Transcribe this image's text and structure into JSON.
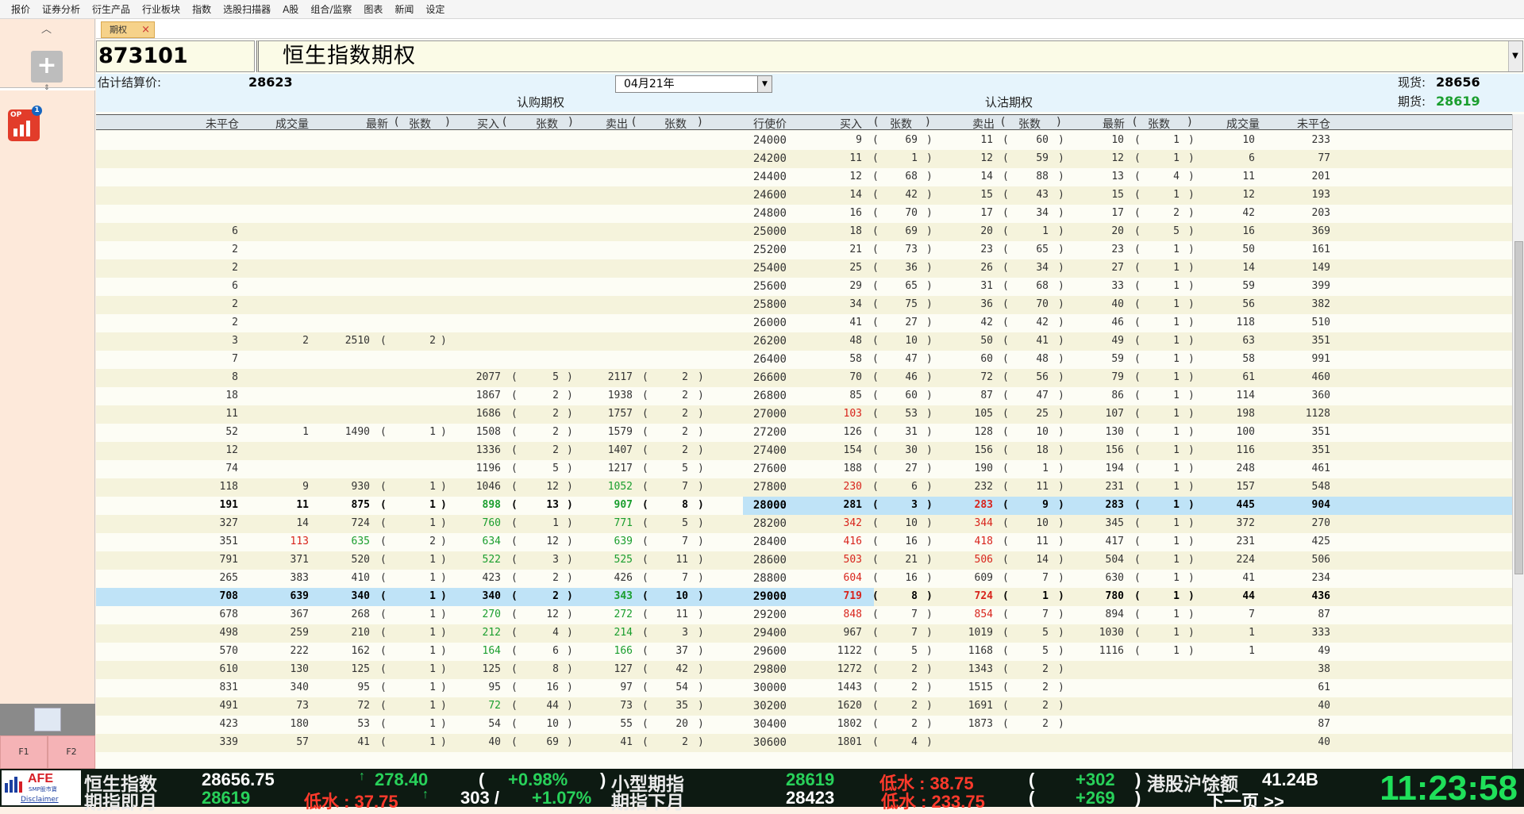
{
  "menu": [
    "报价",
    "证券分析",
    "衍生产品",
    "行业板块",
    "指数",
    "选股扫描器",
    "A股",
    "组合/监察",
    "图表",
    "新闻",
    "设定"
  ],
  "sidebar": {
    "f1": "F1",
    "f2": "F2",
    "op_badge": "1",
    "op_label": "OP"
  },
  "tab": {
    "label": "期权",
    "close": "×"
  },
  "header": {
    "code": "873101",
    "title": "恒生指数期权"
  },
  "info": {
    "est_settle_label": "估计结算价:",
    "est_settle_value": "28623",
    "spot_label": "现货:",
    "spot_value": "28656",
    "futures_label": "期货:",
    "futures_value": "28619",
    "call_label": "认购期权",
    "put_label": "认沽期权",
    "expiry": "04月21年"
  },
  "columns": {
    "oi": "未平仓",
    "vol": "成交量",
    "last": "最新",
    "lots": "张数",
    "bid": "买入",
    "ask": "卖出",
    "strike": "行使价",
    "open_paren": "(",
    "close_paren": ")"
  },
  "rows": [
    {
      "strike": "24000",
      "c": [
        "",
        "",
        "",
        "",
        "",
        "",
        "",
        "",
        ""
      ],
      "p": [
        "9",
        "69",
        "11",
        "60",
        "10",
        "1",
        "10",
        "233"
      ],
      "pc": [
        "",
        "",
        "",
        "",
        "",
        "",
        "",
        ""
      ]
    },
    {
      "strike": "24200",
      "c": [
        "",
        "",
        "",
        "",
        "",
        "",
        "",
        "",
        ""
      ],
      "p": [
        "11",
        "1",
        "12",
        "59",
        "12",
        "1",
        "6",
        "77"
      ],
      "pc": [
        "",
        "",
        "",
        "",
        "",
        "",
        "",
        ""
      ]
    },
    {
      "strike": "24400",
      "c": [
        "",
        "",
        "",
        "",
        "",
        "",
        "",
        "",
        ""
      ],
      "p": [
        "12",
        "68",
        "14",
        "88",
        "13",
        "4",
        "11",
        "201"
      ],
      "pc": [
        "",
        "",
        "",
        "",
        "",
        "",
        "",
        ""
      ]
    },
    {
      "strike": "24600",
      "c": [
        "",
        "",
        "",
        "",
        "",
        "",
        "",
        "",
        ""
      ],
      "p": [
        "14",
        "42",
        "15",
        "43",
        "15",
        "1",
        "12",
        "193"
      ],
      "pc": [
        "",
        "",
        "",
        "",
        "",
        "",
        "",
        ""
      ]
    },
    {
      "strike": "24800",
      "c": [
        "",
        "",
        "",
        "",
        "",
        "",
        "",
        "",
        ""
      ],
      "p": [
        "16",
        "70",
        "17",
        "34",
        "17",
        "2",
        "42",
        "203"
      ],
      "pc": [
        "",
        "",
        "",
        "",
        "",
        "",
        "",
        ""
      ]
    },
    {
      "strike": "25000",
      "c": [
        "6",
        "",
        "",
        "",
        "",
        "",
        "",
        "",
        ""
      ],
      "p": [
        "18",
        "69",
        "20",
        "1",
        "20",
        "5",
        "16",
        "369"
      ],
      "pc": [
        "",
        "",
        "",
        "",
        "",
        "",
        "",
        ""
      ]
    },
    {
      "strike": "25200",
      "c": [
        "2",
        "",
        "",
        "",
        "",
        "",
        "",
        "",
        ""
      ],
      "p": [
        "21",
        "73",
        "23",
        "65",
        "23",
        "1",
        "50",
        "161"
      ],
      "pc": [
        "",
        "",
        "",
        "",
        "",
        "",
        "",
        ""
      ]
    },
    {
      "strike": "25400",
      "c": [
        "2",
        "",
        "",
        "",
        "",
        "",
        "",
        "",
        ""
      ],
      "p": [
        "25",
        "36",
        "26",
        "34",
        "27",
        "1",
        "14",
        "149"
      ],
      "pc": [
        "",
        "",
        "",
        "",
        "",
        "",
        "",
        ""
      ]
    },
    {
      "strike": "25600",
      "c": [
        "6",
        "",
        "",
        "",
        "",
        "",
        "",
        "",
        ""
      ],
      "p": [
        "29",
        "65",
        "31",
        "68",
        "33",
        "1",
        "59",
        "399"
      ],
      "pc": [
        "",
        "",
        "",
        "",
        "",
        "",
        "",
        ""
      ]
    },
    {
      "strike": "25800",
      "c": [
        "2",
        "",
        "",
        "",
        "",
        "",
        "",
        "",
        ""
      ],
      "p": [
        "34",
        "75",
        "36",
        "70",
        "40",
        "1",
        "56",
        "382"
      ],
      "pc": [
        "",
        "",
        "",
        "",
        "",
        "",
        "",
        ""
      ]
    },
    {
      "strike": "26000",
      "c": [
        "2",
        "",
        "",
        "",
        "",
        "",
        "",
        "",
        ""
      ],
      "p": [
        "41",
        "27",
        "42",
        "42",
        "46",
        "1",
        "118",
        "510"
      ],
      "pc": [
        "",
        "",
        "",
        "",
        "",
        "",
        "",
        ""
      ]
    },
    {
      "strike": "26200",
      "c": [
        "3",
        "2",
        "2510",
        "2",
        "",
        "",
        "",
        "",
        ""
      ],
      "p": [
        "48",
        "10",
        "50",
        "41",
        "49",
        "1",
        "63",
        "351"
      ],
      "pc": [
        "",
        "",
        "",
        "",
        "",
        "",
        "",
        ""
      ]
    },
    {
      "strike": "26400",
      "c": [
        "7",
        "",
        "",
        "",
        "",
        "",
        "",
        "",
        ""
      ],
      "p": [
        "58",
        "47",
        "60",
        "48",
        "59",
        "1",
        "58",
        "991"
      ],
      "pc": [
        "",
        "",
        "",
        "",
        "",
        "",
        "",
        ""
      ]
    },
    {
      "strike": "26600",
      "c": [
        "8",
        "",
        "",
        "",
        "2077",
        "5",
        "2117",
        "2",
        ""
      ],
      "p": [
        "70",
        "46",
        "72",
        "56",
        "79",
        "1",
        "61",
        "460"
      ],
      "pc": [
        "",
        "",
        "",
        "",
        "",
        "",
        "",
        ""
      ]
    },
    {
      "strike": "26800",
      "c": [
        "18",
        "",
        "",
        "",
        "1867",
        "2",
        "1938",
        "2",
        ""
      ],
      "p": [
        "85",
        "60",
        "87",
        "47",
        "86",
        "1",
        "114",
        "360"
      ],
      "pc": [
        "",
        "",
        "",
        "",
        "",
        "",
        "",
        ""
      ]
    },
    {
      "strike": "27000",
      "c": [
        "11",
        "",
        "",
        "",
        "1686",
        "2",
        "1757",
        "2",
        ""
      ],
      "p": [
        "103",
        "53",
        "105",
        "25",
        "107",
        "1",
        "198",
        "1128"
      ],
      "pc": [
        "dn",
        "",
        "",
        "",
        "",
        "",
        "",
        ""
      ]
    },
    {
      "strike": "27200",
      "c": [
        "52",
        "1",
        "1490",
        "1",
        "1508",
        "2",
        "1579",
        "2",
        ""
      ],
      "p": [
        "126",
        "31",
        "128",
        "10",
        "130",
        "1",
        "100",
        "351"
      ],
      "pc": [
        "",
        "",
        "",
        "",
        "",
        "",
        "",
        ""
      ]
    },
    {
      "strike": "27400",
      "c": [
        "12",
        "",
        "",
        "",
        "1336",
        "2",
        "1407",
        "2",
        ""
      ],
      "p": [
        "154",
        "30",
        "156",
        "18",
        "156",
        "1",
        "116",
        "351"
      ],
      "pc": [
        "",
        "",
        "",
        "",
        "",
        "",
        "",
        ""
      ]
    },
    {
      "strike": "27600",
      "c": [
        "74",
        "",
        "",
        "",
        "1196",
        "5",
        "1217",
        "5",
        ""
      ],
      "p": [
        "188",
        "27",
        "190",
        "1",
        "194",
        "1",
        "248",
        "461"
      ],
      "pc": [
        "",
        "",
        "",
        "",
        "",
        "",
        "",
        ""
      ]
    },
    {
      "strike": "27800",
      "c": [
        "118",
        "9",
        "930",
        "1",
        "1046",
        "12",
        "1052",
        "7",
        ""
      ],
      "p": [
        "230",
        "6",
        "232",
        "11",
        "231",
        "1",
        "157",
        "548"
      ],
      "pc": [
        "dn",
        "",
        "",
        "",
        "",
        "",
        "",
        ""
      ],
      "cc": [
        "",
        "",
        "",
        "",
        "",
        "",
        "up",
        "",
        ""
      ]
    },
    {
      "strike": "28000",
      "c": [
        "191",
        "11",
        "875",
        "1",
        "898",
        "13",
        "907",
        "8",
        ""
      ],
      "p": [
        "281",
        "3",
        "283",
        "9",
        "283",
        "1",
        "445",
        "904"
      ],
      "pc": [
        "",
        "",
        "dn",
        "",
        "",
        "",
        "",
        ""
      ],
      "cc": [
        "",
        "",
        "",
        "",
        "up",
        "",
        "up",
        "",
        ""
      ],
      "put_hl": true
    },
    {
      "strike": "28200",
      "c": [
        "327",
        "14",
        "724",
        "1",
        "760",
        "1",
        "771",
        "5",
        ""
      ],
      "p": [
        "342",
        "10",
        "344",
        "10",
        "345",
        "1",
        "372",
        "270"
      ],
      "pc": [
        "dn",
        "",
        "dn",
        "",
        "",
        "",
        "",
        ""
      ],
      "cc": [
        "",
        "",
        "",
        "",
        "up",
        "",
        "up",
        "",
        ""
      ]
    },
    {
      "strike": "28400",
      "c": [
        "351",
        "113",
        "635",
        "2",
        "634",
        "12",
        "639",
        "7",
        ""
      ],
      "p": [
        "416",
        "16",
        "418",
        "11",
        "417",
        "1",
        "231",
        "425"
      ],
      "pc": [
        "dn",
        "",
        "dn",
        "",
        "",
        "",
        "",
        ""
      ],
      "cc": [
        "",
        "dn",
        "up",
        "",
        "up",
        "",
        "up",
        "",
        ""
      ]
    },
    {
      "strike": "28600",
      "c": [
        "791",
        "371",
        "520",
        "1",
        "522",
        "3",
        "525",
        "11",
        ""
      ],
      "p": [
        "503",
        "21",
        "506",
        "14",
        "504",
        "1",
        "224",
        "506"
      ],
      "pc": [
        "dn",
        "",
        "dn",
        "",
        "",
        "",
        "",
        ""
      ],
      "cc": [
        "",
        "",
        "",
        "",
        "up",
        "",
        "up",
        "",
        ""
      ]
    },
    {
      "strike": "28800",
      "c": [
        "265",
        "383",
        "410",
        "1",
        "423",
        "2",
        "426",
        "7",
        ""
      ],
      "p": [
        "604",
        "16",
        "609",
        "7",
        "630",
        "1",
        "41",
        "234"
      ],
      "pc": [
        "dn",
        "",
        "",
        "",
        "",
        "",
        "",
        ""
      ]
    },
    {
      "strike": "29000",
      "c": [
        "708",
        "639",
        "340",
        "1",
        "340",
        "2",
        "343",
        "10",
        ""
      ],
      "p": [
        "719",
        "8",
        "724",
        "1",
        "780",
        "1",
        "44",
        "436"
      ],
      "pc": [
        "dn",
        "",
        "dn",
        "",
        "",
        "",
        "",
        ""
      ],
      "cc": [
        "",
        "",
        "",
        "",
        "",
        "",
        "up",
        "",
        ""
      ],
      "call_hl": true
    },
    {
      "strike": "29200",
      "c": [
        "678",
        "367",
        "268",
        "1",
        "270",
        "12",
        "272",
        "11",
        ""
      ],
      "p": [
        "848",
        "7",
        "854",
        "7",
        "894",
        "1",
        "7",
        "87"
      ],
      "pc": [
        "dn",
        "",
        "dn",
        "",
        "",
        "",
        "",
        ""
      ],
      "cc": [
        "",
        "",
        "",
        "",
        "up",
        "",
        "up",
        "",
        ""
      ]
    },
    {
      "strike": "29400",
      "c": [
        "498",
        "259",
        "210",
        "1",
        "212",
        "4",
        "214",
        "3",
        ""
      ],
      "p": [
        "967",
        "7",
        "1019",
        "5",
        "1030",
        "1",
        "1",
        "333"
      ],
      "pc": [
        "",
        "",
        "",
        "",
        "",
        "",
        "",
        ""
      ],
      "cc": [
        "",
        "",
        "",
        "",
        "up",
        "",
        "up",
        "",
        ""
      ]
    },
    {
      "strike": "29600",
      "c": [
        "570",
        "222",
        "162",
        "1",
        "164",
        "6",
        "166",
        "37",
        ""
      ],
      "p": [
        "1122",
        "5",
        "1168",
        "5",
        "1116",
        "1",
        "1",
        "49"
      ],
      "pc": [
        "",
        "",
        "",
        "",
        "",
        "",
        "",
        ""
      ],
      "cc": [
        "",
        "",
        "",
        "",
        "up",
        "",
        "up",
        "",
        ""
      ]
    },
    {
      "strike": "29800",
      "c": [
        "610",
        "130",
        "125",
        "1",
        "125",
        "8",
        "127",
        "42",
        ""
      ],
      "p": [
        "1272",
        "2",
        "1343",
        "2",
        "",
        "",
        "",
        "38"
      ],
      "pc": [
        "",
        "",
        "",
        "",
        "",
        "",
        "",
        ""
      ]
    },
    {
      "strike": "30000",
      "c": [
        "831",
        "340",
        "95",
        "1",
        "95",
        "16",
        "97",
        "54",
        ""
      ],
      "p": [
        "1443",
        "2",
        "1515",
        "2",
        "",
        "",
        "",
        "61"
      ],
      "pc": [
        "",
        "",
        "",
        "",
        "",
        "",
        "",
        ""
      ]
    },
    {
      "strike": "30200",
      "c": [
        "491",
        "73",
        "72",
        "1",
        "72",
        "44",
        "73",
        "35",
        ""
      ],
      "p": [
        "1620",
        "2",
        "1691",
        "2",
        "",
        "",
        "",
        "40"
      ],
      "pc": [
        "",
        "",
        "",
        "",
        "",
        "",
        "",
        ""
      ],
      "cc": [
        "",
        "",
        "",
        "",
        "up",
        "",
        "",
        "",
        ""
      ]
    },
    {
      "strike": "30400",
      "c": [
        "423",
        "180",
        "53",
        "1",
        "54",
        "10",
        "55",
        "20",
        ""
      ],
      "p": [
        "1802",
        "2",
        "1873",
        "2",
        "",
        "",
        "",
        "87"
      ],
      "pc": [
        "",
        "",
        "",
        "",
        "",
        "",
        "",
        ""
      ]
    },
    {
      "strike": "30600",
      "c": [
        "339",
        "57",
        "41",
        "1",
        "40",
        "69",
        "41",
        "2",
        ""
      ],
      "p": [
        "1801",
        "4",
        "",
        "",
        "",
        "",
        "",
        "40"
      ],
      "pc": [
        "",
        "",
        "",
        "",
        "",
        "",
        "",
        ""
      ]
    }
  ],
  "ticker": {
    "logo_text": "AFE",
    "logo_sub": "SMP股市寶",
    "disclaimer": "Disclaimer",
    "hsi_label": "恒生指数",
    "hsi_value": "28656.75",
    "hsi_arrow": "↑",
    "hsi_change": "278.40",
    "hsi_pct": "+0.98%",
    "open": "(",
    "close": ")",
    "mini_label": "小型期指",
    "mini_value": "28619",
    "mini_disc": "低水 : 38.75",
    "mini_oi": "+302",
    "connect_label": "港股沪馀额",
    "connect_value": "41.24B",
    "fut_label": "期指即月",
    "fut_value": "28619",
    "fut_disc": "低水 : 37.75",
    "fut_arrow": "↑",
    "fut_oi": "303 /",
    "fut_pct": "+1.07%",
    "next_label": "期指下月",
    "next_value": "28423",
    "next_disc": "低水 : 233.75",
    "next_oi": "+269",
    "next_page": "下一页 >>",
    "clock": "11:23:58"
  }
}
